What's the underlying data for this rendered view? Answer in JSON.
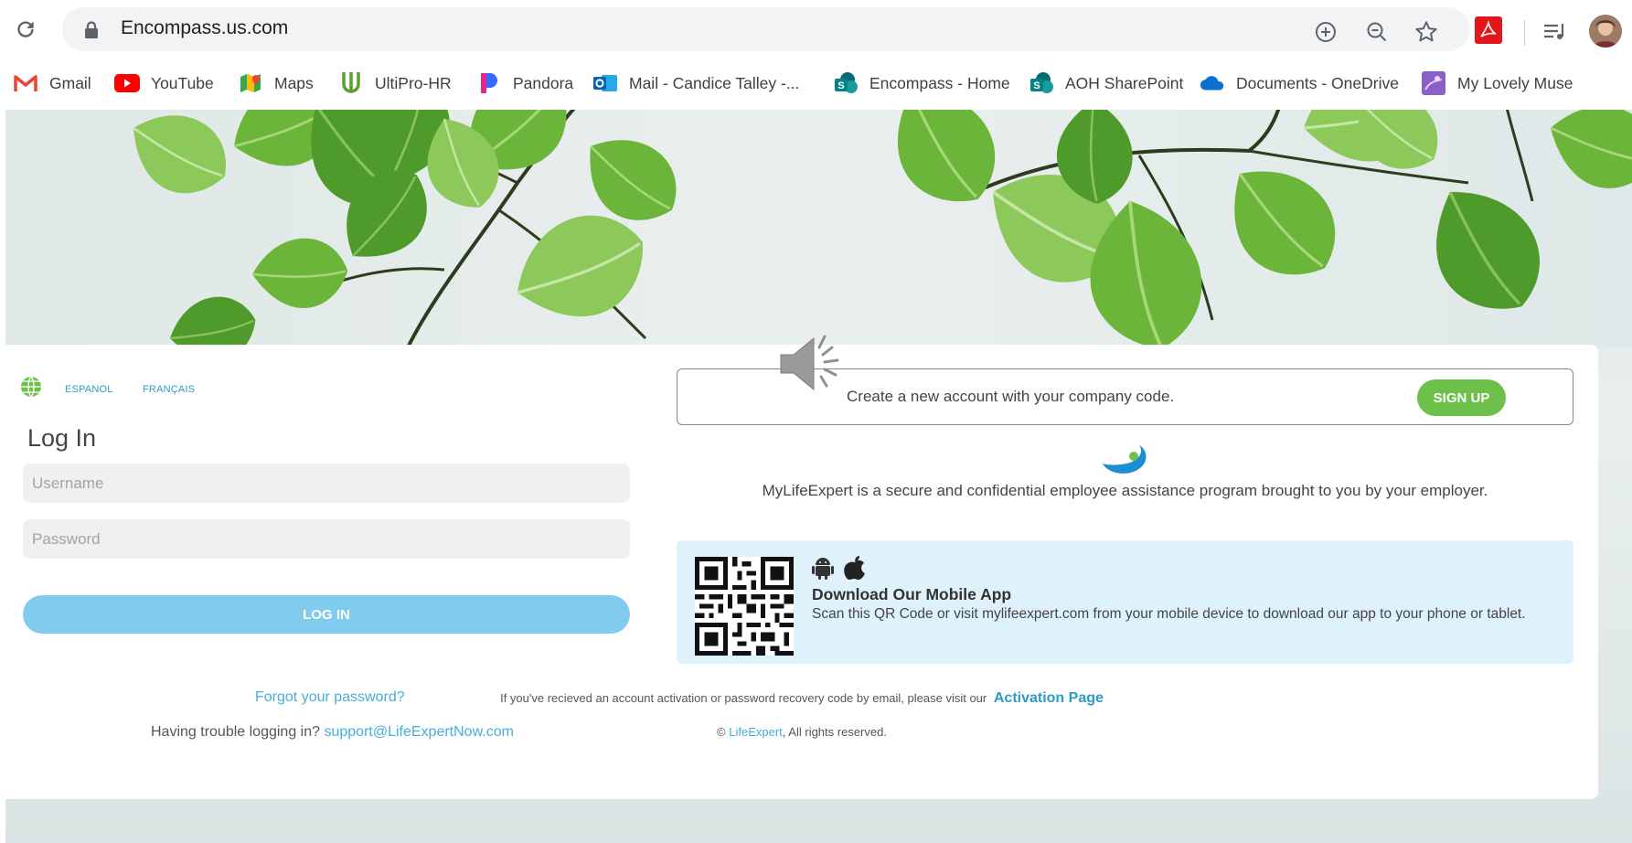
{
  "browser": {
    "url": "Encompass.us.com",
    "bookmarks": [
      {
        "label": "Gmail",
        "icon": "gmail-icon"
      },
      {
        "label": "YouTube",
        "icon": "youtube-icon"
      },
      {
        "label": "Maps",
        "icon": "maps-icon"
      },
      {
        "label": "UltiPro-HR",
        "icon": "ultipro-icon"
      },
      {
        "label": "Pandora",
        "icon": "pandora-icon"
      },
      {
        "label": "Mail - Candice Talley -...",
        "icon": "outlook-icon"
      },
      {
        "label": "Encompass - Home",
        "icon": "sharepoint-icon"
      },
      {
        "label": "AOH SharePoint",
        "icon": "sharepoint-icon"
      },
      {
        "label": "Documents - OneDrive",
        "icon": "onedrive-icon"
      },
      {
        "label": "My Lovely Muse",
        "icon": "muse-icon"
      }
    ]
  },
  "languages": [
    "ESPANOL",
    "FRANÇAIS"
  ],
  "login": {
    "title": "Log In",
    "username_placeholder": "Username",
    "password_placeholder": "Password",
    "button": "LOG IN",
    "forgot": "Forgot your password?",
    "trouble_text": "Having trouble logging in?",
    "support_email": "support@LifeExpertNow.com"
  },
  "signup": {
    "text": "Create a new account with your company code.",
    "button": "SIGN UP"
  },
  "tagline": "MyLifeExpert is a secure and confidential employee assistance program brought to you by your employer.",
  "app": {
    "title": "Download Our Mobile App",
    "description": "Scan this QR Code or visit mylifeexpert.com from your mobile device to download our app to your phone or tablet."
  },
  "footer": {
    "activation_text": "If you've recieved an account activation or password recovery code by email, please visit our",
    "activation_link": "Activation Page",
    "copyright_symbol": "©",
    "copyright_link": "LifeExpert",
    "copyright_rest": ", All rights reserved."
  },
  "colors": {
    "accent_blue": "#47aed6",
    "login_button": "#81cbee",
    "signup_button": "#6dc14b",
    "app_panel": "#dff1fb"
  }
}
